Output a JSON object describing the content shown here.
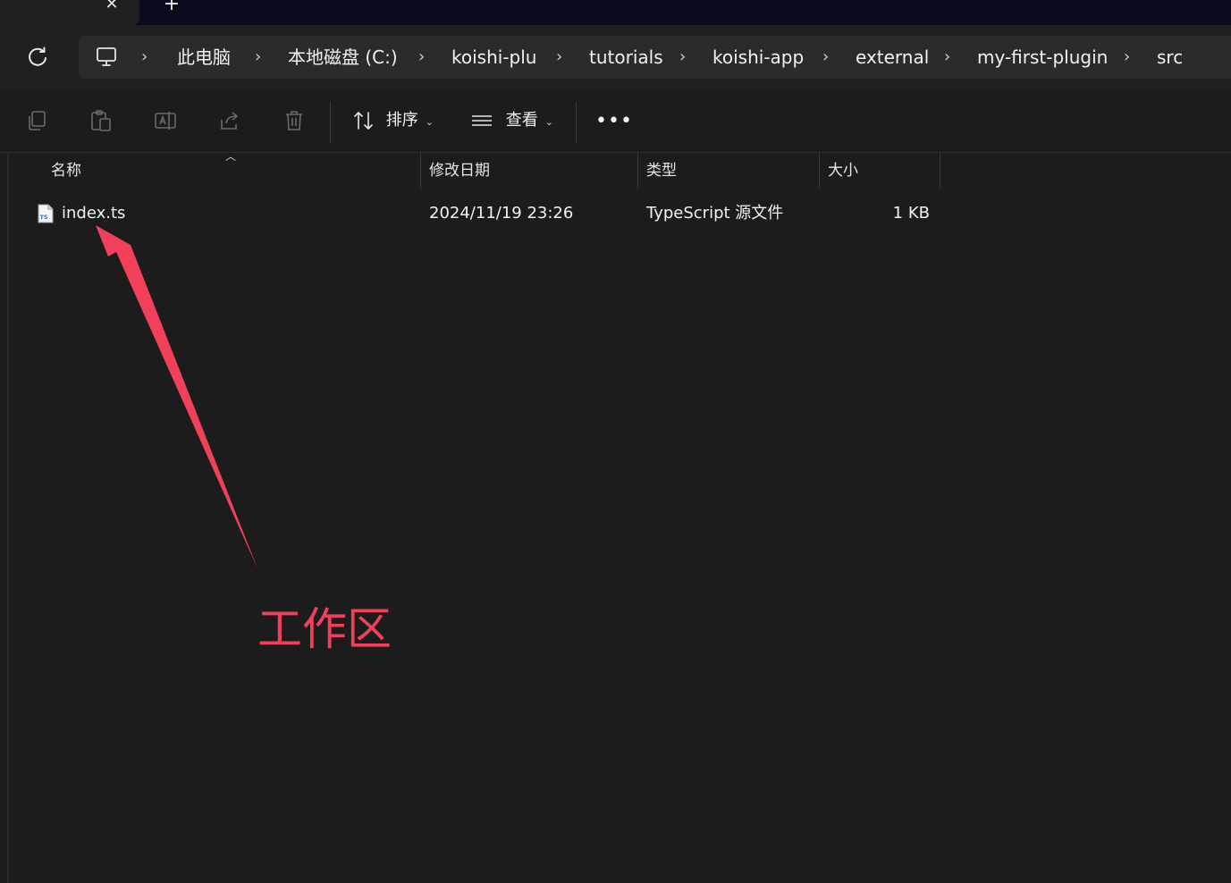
{
  "tabs": {
    "close_glyph": "✕",
    "new_glyph": "+"
  },
  "breadcrumb": [
    "此电脑",
    "本地磁盘 (C:)",
    "koishi-plu",
    "tutorials",
    "koishi-app",
    "external",
    "my-first-plugin",
    "src"
  ],
  "toolbar": {
    "sort_label": "排序",
    "view_label": "查看",
    "more_label": "•••"
  },
  "columns": {
    "name": "名称",
    "modified": "修改日期",
    "type": "类型",
    "size": "大小"
  },
  "files": [
    {
      "name": "index.ts",
      "modified": "2024/11/19 23:26",
      "type": "TypeScript 源文件",
      "size": "1 KB",
      "icon": "typescript-file-icon"
    }
  ],
  "annotation": {
    "text": "工作区",
    "color": "#f0405a"
  },
  "colors": {
    "background": "#1c1c1c",
    "address_bar": "#2b2b2b",
    "tab_strip": "#0b0b1e"
  }
}
